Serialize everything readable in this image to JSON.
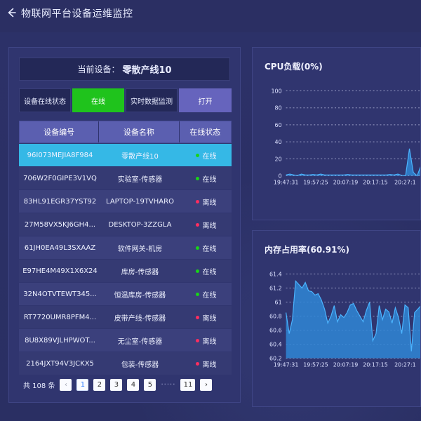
{
  "app": {
    "title": "物联网平台设备运维监控",
    "icons": {
      "back": "arrow-left-icon"
    }
  },
  "left_panel": {
    "current_device_label": "当前设备：",
    "current_device_name": "零散产线10",
    "online_status_label": "设备在线状态",
    "online_status_value": "在线",
    "realtime_label": "实时数据监测",
    "realtime_button": "打开",
    "table": {
      "headers": [
        "设备编号",
        "设备名称",
        "在线状态"
      ],
      "rows": [
        {
          "id": "96I073MEJIA8F984",
          "name": "零散产线10",
          "status": "在线",
          "online": true,
          "selected": true
        },
        {
          "id": "706W2F0GIPE3V1VQ",
          "name": "实验室-传感器",
          "status": "在线",
          "online": true
        },
        {
          "id": "83HL91EGR37YST92",
          "name": "LAPTOP-19TVHARO",
          "status": "离线",
          "online": false
        },
        {
          "id": "27M58VX5KJ6GH4...",
          "name": "DESKTOP-3ZZGLA",
          "status": "离线",
          "online": false
        },
        {
          "id": "61JH0EA49L3SXAAZ",
          "name": "软件网关-机房",
          "status": "在线",
          "online": true
        },
        {
          "id": "E97HE4M49X1X6X24",
          "name": "库房-传感器",
          "status": "在线",
          "online": true
        },
        {
          "id": "32N4OTVTEWT345...",
          "name": "恒温库房-传感器",
          "status": "在线",
          "online": true
        },
        {
          "id": "RT7720UMR8PFM4...",
          "name": "皮带产线-传感器",
          "status": "离线",
          "online": false
        },
        {
          "id": "8U8X89VJLHPWOT...",
          "name": "无尘室-传感器",
          "status": "离线",
          "online": false
        },
        {
          "id": "2164JXT94V3JCKX5",
          "name": "包装-传感器",
          "status": "离线",
          "online": false
        }
      ]
    },
    "pagination": {
      "total_text": "共 108 条",
      "prev_icon": "chevron-left-icon",
      "pages": [
        "1",
        "2",
        "3",
        "4",
        "5"
      ],
      "ellipsis": "·····",
      "last_page": "11",
      "next_icon": "chevron-right-icon",
      "active_page": "1"
    }
  },
  "colors": {
    "background": "#2b2f63",
    "panel": "#30356f",
    "selected_row": "#35b8e6",
    "online": "#19d319",
    "offline": "#ff2d5f",
    "button_green": "#1fc31c",
    "button_purple": "#6664bd",
    "chart_line": "#4bb4ff",
    "chart_fill": "#2f86d6"
  },
  "chart_data": [
    {
      "type": "area",
      "title": "CPU负载(0%)",
      "x_ticks": [
        "19:47:31",
        "19:57:25",
        "20:07:19",
        "20:17:15",
        "20:27:1"
      ],
      "y_ticks": [
        0,
        20,
        40,
        60,
        80,
        100
      ],
      "ylim": [
        0,
        100
      ],
      "grid": true,
      "values": [
        1,
        2,
        1,
        0.5,
        2,
        1,
        1,
        1.5,
        1,
        2,
        1,
        1,
        1,
        1,
        1,
        1,
        1.5,
        1,
        1,
        1,
        1,
        1,
        1,
        1,
        1,
        1,
        1,
        1.5,
        1,
        2,
        0.5,
        0,
        32,
        4,
        0,
        12
      ]
    },
    {
      "type": "area",
      "title": "内存占用率(60.91%)",
      "x_ticks": [
        "19:47:31",
        "19:57:25",
        "20:07:19",
        "20:17:15",
        "20:27:1"
      ],
      "y_ticks": [
        60.2,
        60.4,
        60.6,
        60.8,
        61,
        61.2,
        61.4
      ],
      "ylim": [
        60.2,
        61.4
      ],
      "grid": true,
      "values": [
        60.85,
        60.55,
        60.75,
        61.3,
        61.25,
        61.2,
        61.28,
        61.16,
        61.15,
        61.1,
        61.12,
        61.03,
        60.9,
        60.7,
        60.8,
        60.95,
        60.72,
        60.82,
        60.78,
        60.85,
        60.96,
        60.98,
        60.88,
        60.8,
        60.72,
        60.88,
        61.0,
        60.45,
        60.55,
        60.95,
        60.75,
        60.9,
        60.86,
        60.7,
        60.92,
        60.78,
        60.55,
        60.96,
        60.92,
        60.3,
        60.85,
        60.9,
        60.95
      ]
    }
  ]
}
